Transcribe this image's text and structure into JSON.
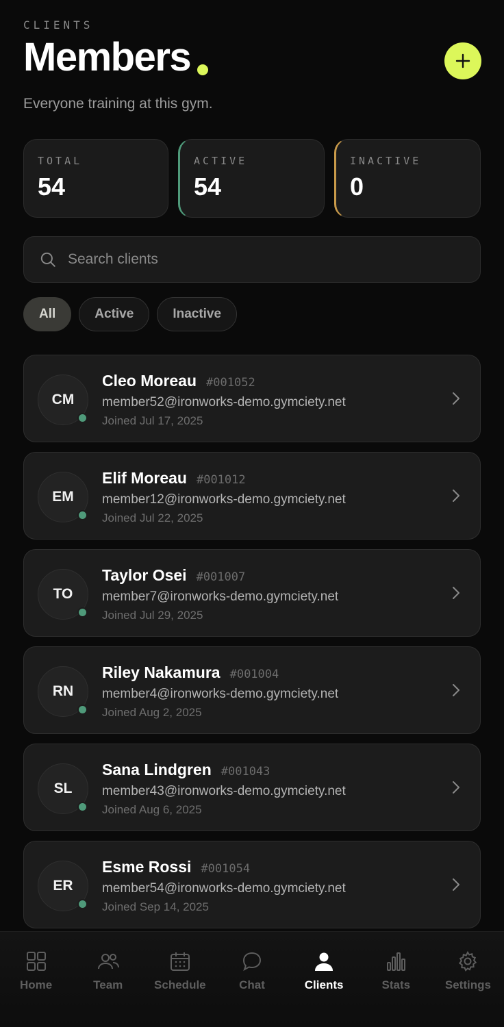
{
  "header": {
    "eyebrow": "CLIENTS",
    "title": "Members",
    "subtitle": "Everyone training at this gym.",
    "accent_color": "#dcf75a",
    "add_button_icon": "plus-icon"
  },
  "stats": [
    {
      "label": "TOTAL",
      "value": "54"
    },
    {
      "label": "ACTIVE",
      "value": "54",
      "accent": "#4f9a7a"
    },
    {
      "label": "INACTIVE",
      "value": "0",
      "accent": "#c99a4a"
    }
  ],
  "search": {
    "placeholder": "Search clients",
    "value": "",
    "icon": "search-icon"
  },
  "filters": [
    {
      "label": "All",
      "selected": true
    },
    {
      "label": "Active",
      "selected": false
    },
    {
      "label": "Inactive",
      "selected": false
    }
  ],
  "members": [
    {
      "initials": "CM",
      "name": "Cleo Moreau",
      "id": "#001052",
      "email": "member52@ironworks-demo.gymciety.net",
      "joined": "Joined Jul 17, 2025"
    },
    {
      "initials": "EM",
      "name": "Elif Moreau",
      "id": "#001012",
      "email": "member12@ironworks-demo.gymciety.net",
      "joined": "Joined Jul 22, 2025"
    },
    {
      "initials": "TO",
      "name": "Taylor Osei",
      "id": "#001007",
      "email": "member7@ironworks-demo.gymciety.net",
      "joined": "Joined Jul 29, 2025"
    },
    {
      "initials": "RN",
      "name": "Riley Nakamura",
      "id": "#001004",
      "email": "member4@ironworks-demo.gymciety.net",
      "joined": "Joined Aug 2, 2025"
    },
    {
      "initials": "SL",
      "name": "Sana Lindgren",
      "id": "#001043",
      "email": "member43@ironworks-demo.gymciety.net",
      "joined": "Joined Aug 6, 2025"
    },
    {
      "initials": "ER",
      "name": "Esme Rossi",
      "id": "#001054",
      "email": "member54@ironworks-demo.gymciety.net",
      "joined": "Joined Sep 14, 2025"
    }
  ],
  "tabbar": [
    {
      "label": "Home",
      "icon": "grid-icon",
      "current": false
    },
    {
      "label": "Team",
      "icon": "team-icon",
      "current": false
    },
    {
      "label": "Schedule",
      "icon": "calendar-icon",
      "current": false
    },
    {
      "label": "Chat",
      "icon": "chat-icon",
      "current": false
    },
    {
      "label": "Clients",
      "icon": "user-icon",
      "current": true
    },
    {
      "label": "Stats",
      "icon": "bar-chart-icon",
      "current": false
    },
    {
      "label": "Settings",
      "icon": "gear-icon",
      "current": false
    }
  ]
}
